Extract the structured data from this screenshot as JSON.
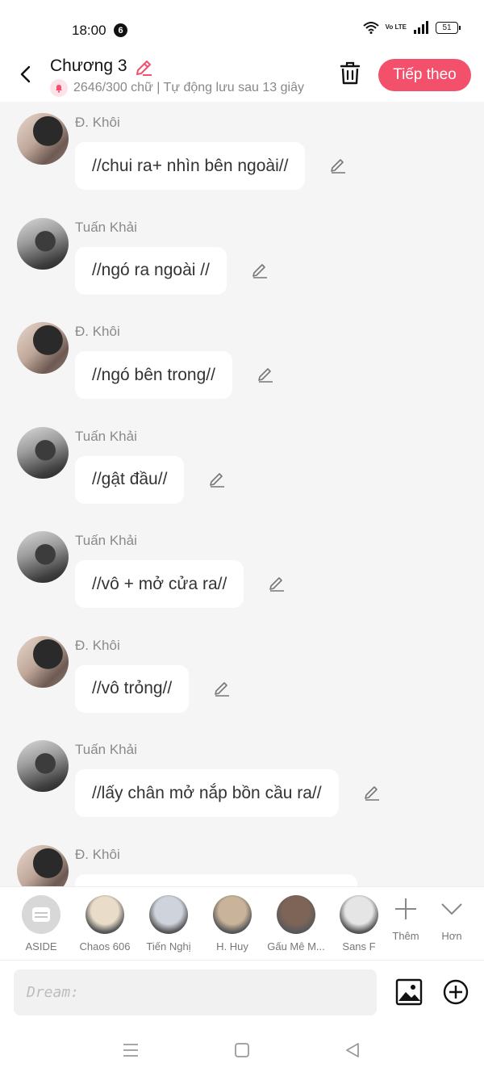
{
  "status_bar": {
    "time": "18:00",
    "notification_count": "6",
    "network_label": "Vo LTE",
    "battery": "51"
  },
  "header": {
    "title": "Chương 3",
    "word_count": "2646/300 chữ | Tự động lưu sau 13 giây",
    "next_label": "Tiếp theo",
    "accent_color": "#f3516b"
  },
  "messages": [
    {
      "sender": "Đ. Khôi",
      "avatar": "khoi",
      "text": "//chui ra+ nhìn bên ngoài//"
    },
    {
      "sender": "Tuấn Khải",
      "avatar": "khai",
      "text": "//ngó ra ngoài //"
    },
    {
      "sender": "Đ. Khôi",
      "avatar": "khoi",
      "text": "//ngó bên trong//"
    },
    {
      "sender": "Tuấn Khải",
      "avatar": "khai",
      "text": "//gật đầu//"
    },
    {
      "sender": "Tuấn Khải",
      "avatar": "khai",
      "text": "//vô + mở cửa ra//"
    },
    {
      "sender": "Đ. Khôi",
      "avatar": "khoi",
      "text": "//vô trỏng//"
    },
    {
      "sender": "Tuấn Khải",
      "avatar": "khai",
      "text": "//lấy chân mở nắp bồn cầu ra//"
    },
    {
      "sender": "Đ. Khôi",
      "avatar": "khoi",
      "text": ""
    }
  ],
  "characters": [
    {
      "name": "ASIDE",
      "icon": "aside-icon"
    },
    {
      "name": "Chaos 606",
      "color": "#e9dcc8"
    },
    {
      "name": "Tiến Nghị",
      "color": "#cfd3dc"
    },
    {
      "name": "H. Huy",
      "color": "#c9b39a"
    },
    {
      "name": "Gấu Mê M...",
      "color": "#7d6457"
    },
    {
      "name": "Sans F",
      "color": "#e5e5e5"
    }
  ],
  "tools": {
    "add_label": "Thêm",
    "more_label": "Hơn"
  },
  "input": {
    "placeholder": "Dream:"
  }
}
